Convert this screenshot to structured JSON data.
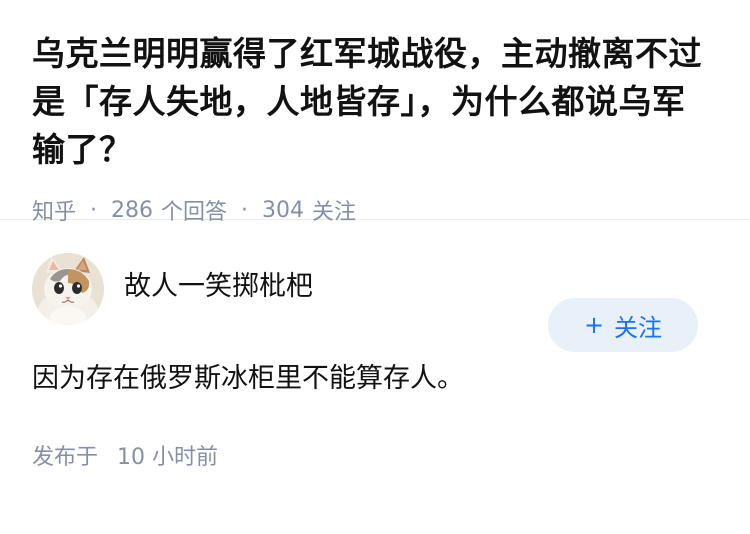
{
  "question": {
    "title": "乌克兰明明赢得了红军城战役，主动撤离不过是「存人失地，人地皆存」，为什么都说乌军输了？",
    "source": "知乎",
    "separator": "·",
    "answer_count": "286",
    "answer_unit": "个回答",
    "follow_count": "304",
    "follow_unit": "关注"
  },
  "answer": {
    "author": {
      "name": "故人一笑掷枇杷",
      "avatar_icon": "cat-avatar-icon"
    },
    "follow_button": {
      "icon": "+",
      "label": "关注"
    },
    "content": "因为存在俄罗斯冰柜里不能算存人。",
    "time_label": "发布于",
    "time_value": "10 小时前"
  },
  "colors": {
    "primary_text": "#121212",
    "secondary_text": "#8590a6",
    "follow_button_bg": "#e8f0fa",
    "follow_button_text": "#1772f6",
    "divider": "#ebebeb"
  }
}
